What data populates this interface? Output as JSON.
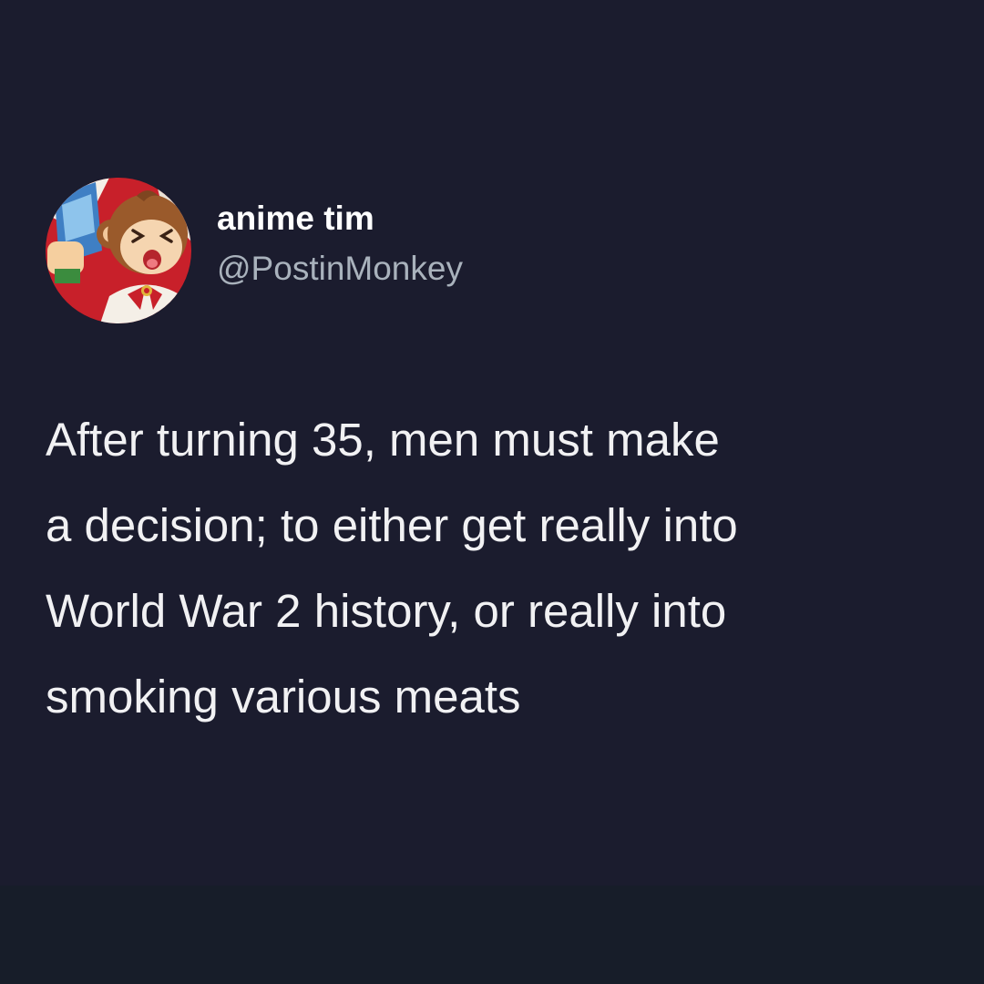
{
  "tweet": {
    "author": {
      "display_name": "anime tim",
      "handle": "@PostinMonkey",
      "avatar_icon": "cartoon-monkey-avatar"
    },
    "text": "After turning 35, men must make\na decision; to either get really into\nWorld War 2 history, or really into\nsmoking various meats"
  },
  "colors": {
    "background": "#1b1c2e",
    "bottom_band": "#171d29",
    "display_name": "#ffffff",
    "handle": "#a9b2bc",
    "text": "#f1f1f3"
  }
}
